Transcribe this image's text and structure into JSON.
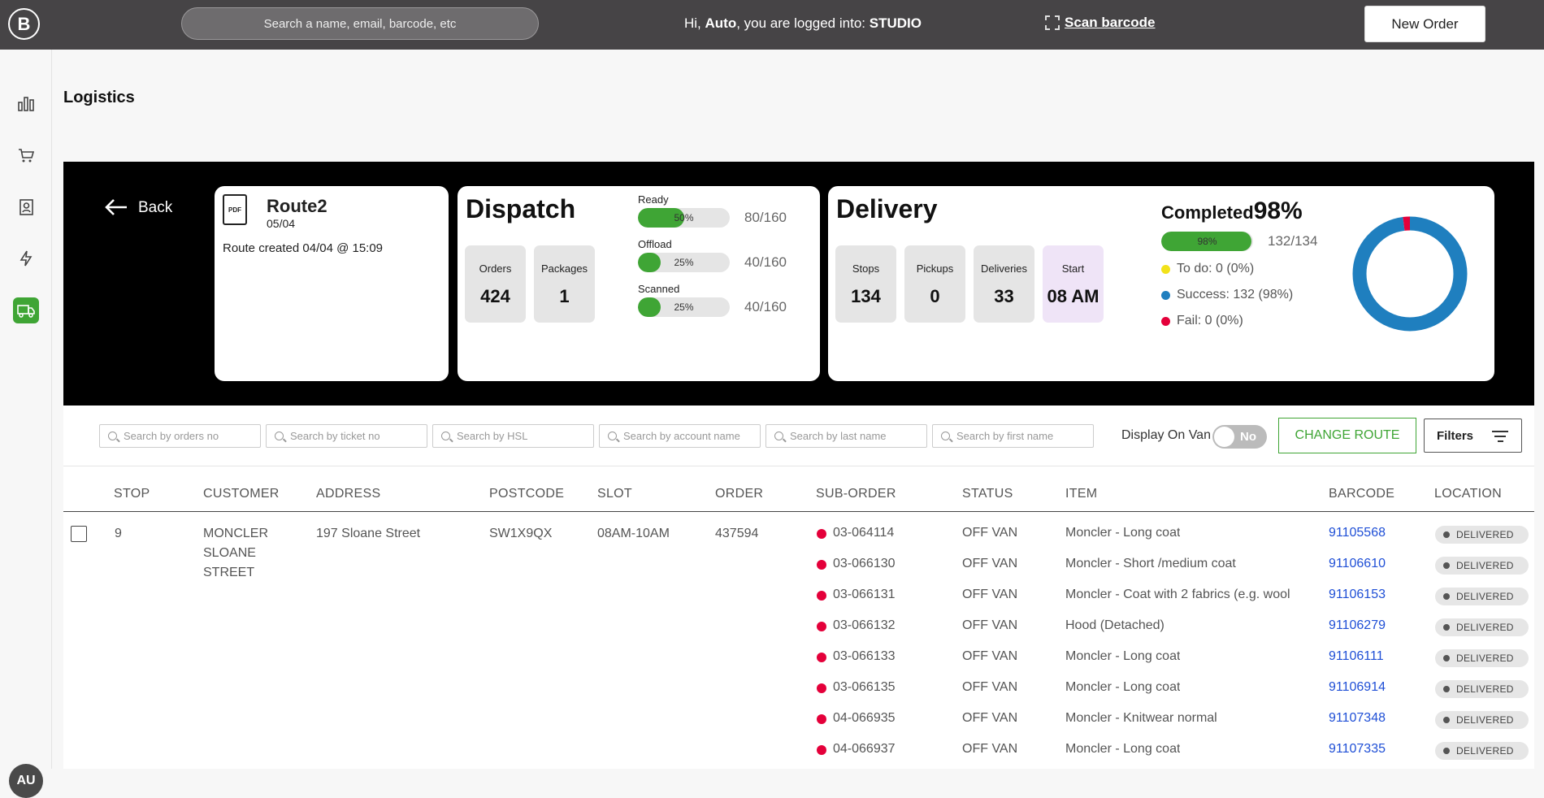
{
  "app": {
    "logo_letter": "B"
  },
  "header": {
    "search_placeholder": "Search a name, email, barcode, etc",
    "greeting_prefix": "Hi, ",
    "user": "Auto",
    "greeting_mid": ", you are logged into: ",
    "store": "STUDIO",
    "scan_label": "Scan barcode",
    "new_order_label": "New Order"
  },
  "sidebar": {
    "avatar_initials": "AU"
  },
  "page": {
    "title": "Logistics"
  },
  "banner": {
    "back_label": "Back",
    "route": {
      "pdf_label": "PDF",
      "name": "Route2",
      "date": "05/04",
      "created": "Route created 04/04 @ 15:09"
    },
    "dispatch": {
      "title": "Dispatch",
      "tiles": [
        {
          "label": "Orders",
          "value": "424"
        },
        {
          "label": "Packages",
          "value": "1"
        }
      ],
      "progress": [
        {
          "label": "Ready",
          "percent": 50,
          "percent_label": "50%",
          "count": "80/160"
        },
        {
          "label": "Offload",
          "percent": 25,
          "percent_label": "25%",
          "count": "40/160"
        },
        {
          "label": "Scanned",
          "percent": 25,
          "percent_label": "25%",
          "count": "40/160"
        }
      ]
    },
    "delivery": {
      "title": "Delivery",
      "tiles": [
        {
          "label": "Stops",
          "value": "134"
        },
        {
          "label": "Pickups",
          "value": "0"
        },
        {
          "label": "Deliveries",
          "value": "33"
        },
        {
          "label": "Start",
          "value": "08 AM"
        }
      ],
      "completed_label": "Completed",
      "completed_value": "98%",
      "completed_percent": 98,
      "completed_percent_label": "98%",
      "completed_count": "132/134",
      "legend": [
        {
          "label": "To do: 0 (0%)",
          "color": "#f2e21a"
        },
        {
          "label": "Success: 132 (98%)",
          "color": "#1f7fbf"
        },
        {
          "label": "Fail: 0 (0%)",
          "color": "#e4003a"
        }
      ],
      "donut": {
        "success_fraction": 0.98,
        "success_color": "#1f7fbf",
        "fail_color": "#e4003a"
      }
    }
  },
  "filters": {
    "inputs": [
      "Search by orders no",
      "Search by ticket no",
      "Search by HSL",
      "Search by account name",
      "Search by last name",
      "Search by first name"
    ],
    "display_on_van_label": "Display On Van",
    "toggle_label": "No",
    "change_route_label": "CHANGE ROUTE",
    "filters_label": "Filters"
  },
  "table": {
    "headers": [
      "STOP",
      "CUSTOMER",
      "ADDRESS",
      "POSTCODE",
      "SLOT",
      "ORDER",
      "SUB-ORDER",
      "STATUS",
      "ITEM",
      "BARCODE",
      "LOCATION"
    ],
    "row": {
      "stop": "9",
      "customer": "MONCLER SLOANE STREET",
      "address": "197 Sloane Street",
      "postcode": "SW1X9QX",
      "slot": "08AM-10AM",
      "order": "437594"
    },
    "sub_rows": [
      {
        "sub_order": "03-064114",
        "status": "OFF VAN",
        "item": "Moncler - Long coat",
        "barcode": "91105568",
        "location": "DELIVERED"
      },
      {
        "sub_order": "03-066130",
        "status": "OFF VAN",
        "item": "Moncler - Short /medium coat",
        "barcode": "91106610",
        "location": "DELIVERED"
      },
      {
        "sub_order": "03-066131",
        "status": "OFF VAN",
        "item": "Moncler - Coat with 2 fabrics (e.g. wool",
        "barcode": "91106153",
        "location": "DELIVERED"
      },
      {
        "sub_order": "03-066132",
        "status": "OFF VAN",
        "item": "Hood (Detached)",
        "barcode": "91106279",
        "location": "DELIVERED"
      },
      {
        "sub_order": "03-066133",
        "status": "OFF VAN",
        "item": "Moncler - Long coat",
        "barcode": "91106111",
        "location": "DELIVERED"
      },
      {
        "sub_order": "03-066135",
        "status": "OFF VAN",
        "item": "Moncler - Long coat",
        "barcode": "91106914",
        "location": "DELIVERED"
      },
      {
        "sub_order": "04-066935",
        "status": "OFF VAN",
        "item": "Moncler - Knitwear normal",
        "barcode": "91107348",
        "location": "DELIVERED"
      },
      {
        "sub_order": "04-066937",
        "status": "OFF VAN",
        "item": "Moncler - Long coat",
        "barcode": "91107335",
        "location": "DELIVERED"
      }
    ]
  }
}
